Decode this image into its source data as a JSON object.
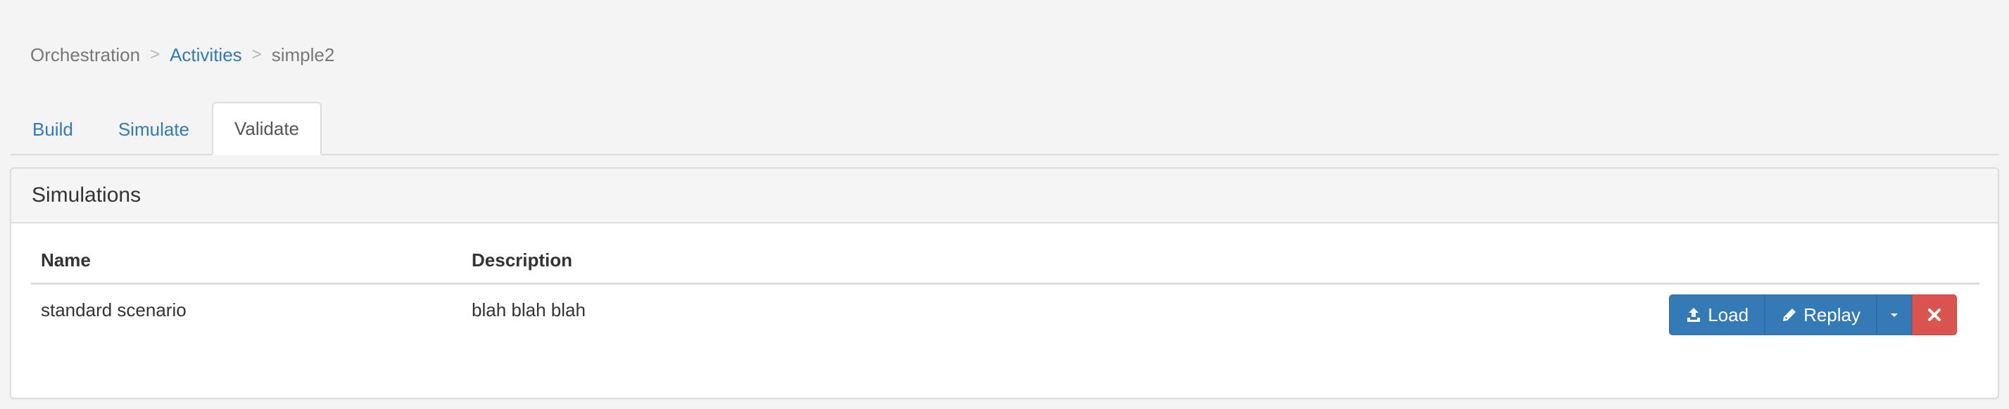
{
  "breadcrumb": {
    "items": [
      {
        "label": "Orchestration"
      },
      {
        "label": "Activities"
      },
      {
        "label": "simple2"
      }
    ],
    "separator": ">"
  },
  "tabs": [
    {
      "label": "Build",
      "active": false
    },
    {
      "label": "Simulate",
      "active": false
    },
    {
      "label": "Validate",
      "active": true
    }
  ],
  "panel": {
    "title": "Simulations",
    "columns": {
      "name": "Name",
      "description": "Description"
    },
    "rows": [
      {
        "name": "standard scenario",
        "description": "blah blah blah"
      }
    ]
  },
  "actions": {
    "load_label": "Load",
    "replay_label": "Replay",
    "load_icon": "upload-icon",
    "replay_icon": "pencil-icon",
    "dropdown_icon": "caret-down-icon",
    "delete_icon": "close-icon"
  },
  "colors": {
    "link": "#337ab7",
    "primary": "#337ab7",
    "danger": "#d9534f",
    "background": "#f4f4f4"
  }
}
